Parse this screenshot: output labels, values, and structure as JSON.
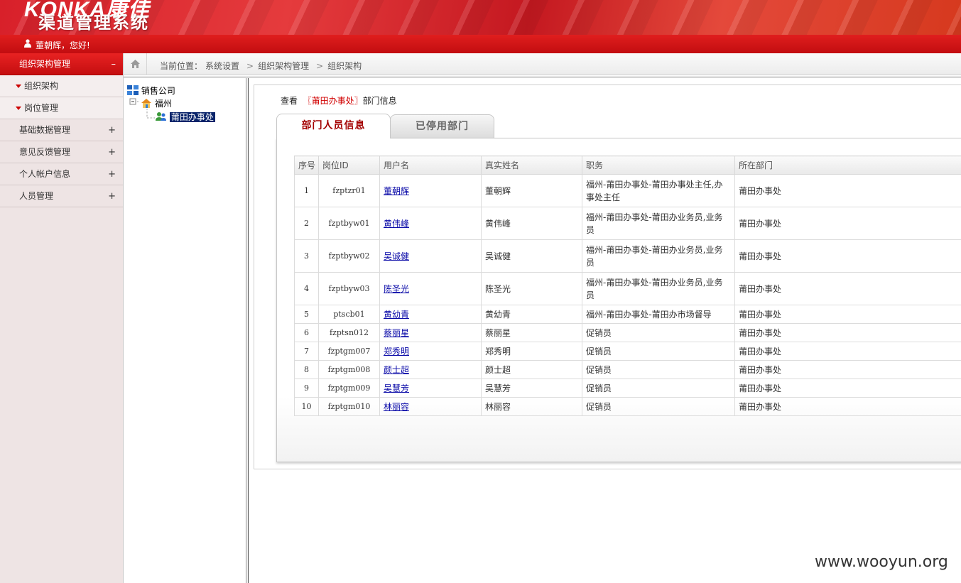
{
  "header": {
    "logo_text": "KONKA康佳",
    "system_title": "渠道管理系统"
  },
  "userbar": {
    "greeting": "董朝辉，您好!"
  },
  "sidebar": {
    "items": [
      {
        "label": "组织架构管理",
        "sign": "–",
        "active": true
      },
      {
        "label": "组织架构",
        "sub": true
      },
      {
        "label": "岗位管理",
        "sub": true
      },
      {
        "label": "基础数据管理",
        "sign": "+"
      },
      {
        "label": "意见反馈管理",
        "sign": "+"
      },
      {
        "label": "个人帐户信息",
        "sign": "+"
      },
      {
        "label": "人员管理",
        "sign": "+"
      }
    ]
  },
  "breadcrumb": {
    "prefix": "当前位置：",
    "parts": [
      "系统设置",
      "组织架构管理",
      "组织架构"
    ]
  },
  "tree": {
    "root": "销售公司",
    "child": "福州",
    "leaf": "莆田办事处"
  },
  "main": {
    "view_prefix": "查看",
    "view_dept": "〖莆田办事处〗",
    "view_suffix": "部门信息",
    "tabs": [
      "部门人员信息",
      "已停用部门"
    ],
    "columns": [
      "序号",
      "岗位ID",
      "用户名",
      "真实姓名",
      "职务",
      "所在部门"
    ],
    "rows": [
      [
        "1",
        "fzptzr01",
        "董朝辉",
        "董朝辉",
        "福州-莆田办事处-莆田办事处主任,办事处主任",
        "莆田办事处"
      ],
      [
        "2",
        "fzptbyw01",
        "黄伟峰",
        "黄伟峰",
        "福州-莆田办事处-莆田办业务员,业务员",
        "莆田办事处"
      ],
      [
        "3",
        "fzptbyw02",
        "吴诚健",
        "吴诚健",
        "福州-莆田办事处-莆田办业务员,业务员",
        "莆田办事处"
      ],
      [
        "4",
        "fzptbyw03",
        "陈圣光",
        "陈圣光",
        "福州-莆田办事处-莆田办业务员,业务员",
        "莆田办事处"
      ],
      [
        "5",
        "ptscb01",
        "黄幼青",
        "黄幼青",
        "福州-莆田办事处-莆田办市场督导",
        "莆田办事处"
      ],
      [
        "6",
        "fzptsn012",
        "蔡丽星",
        "蔡丽星",
        "促销员",
        "莆田办事处"
      ],
      [
        "7",
        "fzptgm007",
        "郑秀明",
        "郑秀明",
        "促销员",
        "莆田办事处"
      ],
      [
        "8",
        "fzptgm008",
        "颜士超",
        "颜士超",
        "促销员",
        "莆田办事处"
      ],
      [
        "9",
        "fzptgm009",
        "吴慧芳",
        "吴慧芳",
        "促销员",
        "莆田办事处"
      ],
      [
        "10",
        "fzptgm010",
        "林丽容",
        "林丽容",
        "促销员",
        "莆田办事处"
      ]
    ]
  },
  "watermark": "www.wooyun.org",
  "colors": {
    "brand_red": "#d8202a",
    "link_blue": "#0a0aa8",
    "dept_red": "#d10000"
  }
}
